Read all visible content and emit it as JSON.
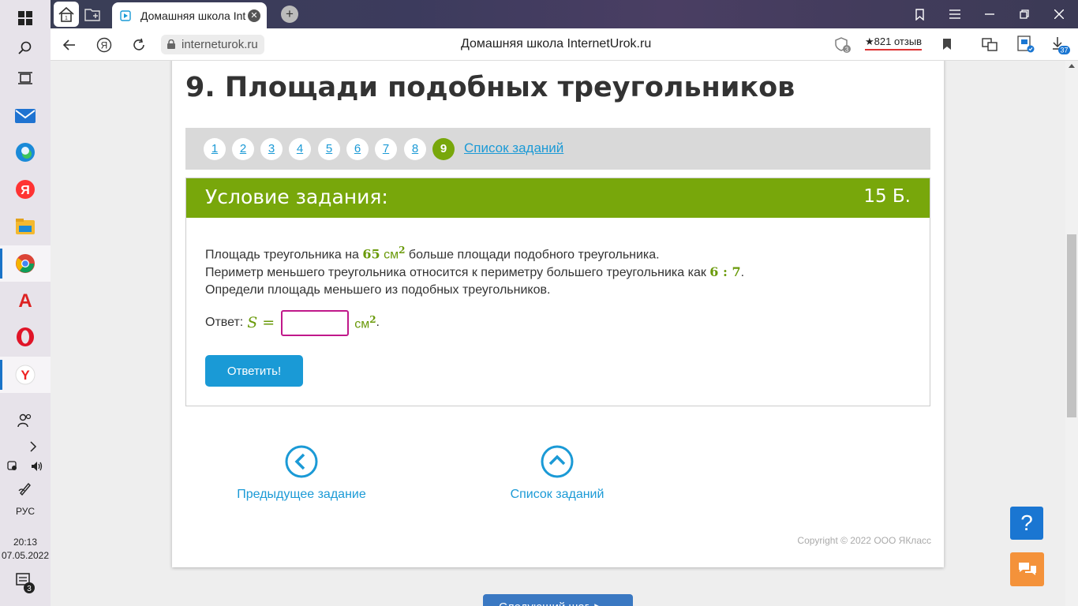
{
  "taskbar": {
    "language": "РУС",
    "time": "20:13",
    "date": "07.05.2022",
    "notifications_count": "3"
  },
  "browser": {
    "tab_title": "Домашняя школа InternetUrok.ru",
    "url": "interneturok.ru",
    "page_title": "Домашняя школа InternetUrok.ru",
    "protect_count": "3",
    "reviews": "★821 отзыв",
    "downloads_count": "37"
  },
  "lesson": {
    "title": "9. Площади подобных треугольников"
  },
  "pager": {
    "pages": [
      "1",
      "2",
      "3",
      "4",
      "5",
      "6",
      "7",
      "8",
      "9"
    ],
    "current": "9",
    "list_link": "Список заданий"
  },
  "task": {
    "header": "Условие задания:",
    "points": "15 Б.",
    "line1_pre": "Площадь треугольника на ",
    "line1_num": "65",
    "line1_unit": " см",
    "line1_exp": "2",
    "line1_post": " больше площади подобного треугольника.",
    "line2_pre": "Периметр меньшего треугольника относится к периметру большего треугольника как ",
    "line2_ratio": "6 : 7",
    "line2_post": ".",
    "line3": "Определи площадь меньшего из подобных треугольников.",
    "answer_label": "Ответ:",
    "answer_var": "S",
    "answer_eq": "=",
    "answer_value": "",
    "answer_unit": "см",
    "answer_exp": "2",
    "answer_dot": ".",
    "submit_label": "Ответить!"
  },
  "navigation": {
    "prev_label": "Предыдущее задание",
    "list_label": "Список заданий"
  },
  "footer": {
    "copyright": "Copyright © 2022 ООО ЯКласс",
    "help": "?",
    "next_label": "Следующий шаг ►"
  },
  "colors": {
    "accent_green": "#78a70b",
    "link_blue": "#1b9ad6",
    "help_blue": "#1a76d2",
    "chat_orange": "#f4923a"
  }
}
